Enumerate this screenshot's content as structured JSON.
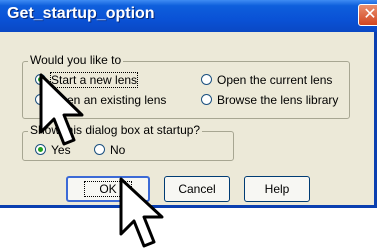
{
  "window": {
    "title": "Get_startup_option",
    "close_glyph": "✕"
  },
  "group1": {
    "legend": "Would you like to",
    "options": [
      {
        "label": "Start a new lens",
        "selected": true
      },
      {
        "label": "Open an existing lens",
        "selected": false
      },
      {
        "label": "Open the current lens",
        "selected": false
      },
      {
        "label": "Browse the lens library",
        "selected": false
      }
    ]
  },
  "group2": {
    "legend": "Show this dialog box at startup?",
    "options": [
      {
        "label": "Yes",
        "selected": true
      },
      {
        "label": "No",
        "selected": false
      }
    ]
  },
  "buttons": {
    "ok": "OK",
    "cancel": "Cancel",
    "help": "Help"
  },
  "icons": {
    "cursor": "arrow-cursor-icon"
  }
}
